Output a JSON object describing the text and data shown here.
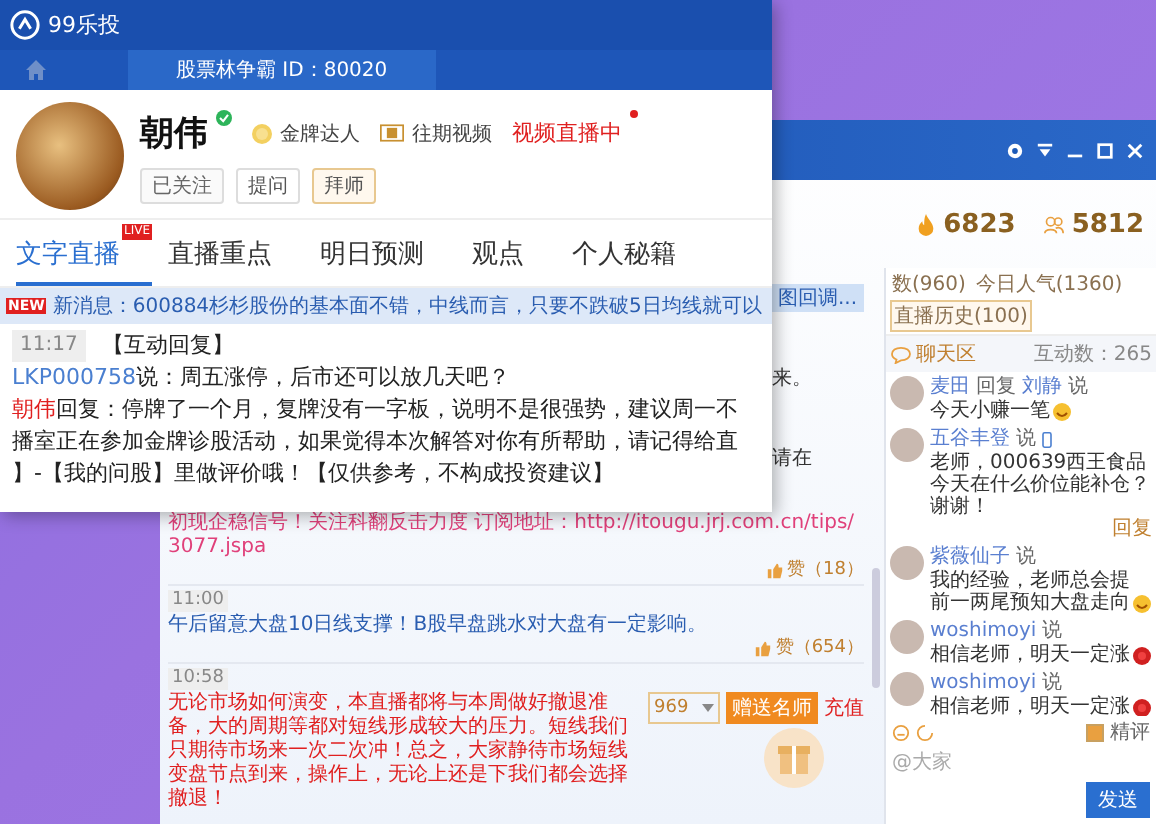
{
  "popup": {
    "app_name": "99乐投",
    "subtitle": "股票林争霸 ID：80020",
    "profile": {
      "name": "朝伟",
      "verified": true,
      "badge": "金牌达人",
      "video_link": "往期视频",
      "live_status": "视频直播中",
      "live": true
    },
    "actions": [
      {
        "label": "已关注",
        "selected": true
      },
      {
        "label": "提问",
        "selected": false
      },
      {
        "label": "拜师",
        "selected": false
      }
    ],
    "tabs": [
      {
        "label": "文字直播",
        "selected": true,
        "badge": "LIVE"
      },
      {
        "label": "直播重点",
        "selected": false
      },
      {
        "label": "明日预测",
        "selected": false
      },
      {
        "label": "观点",
        "selected": false
      },
      {
        "label": "个人秘籍",
        "selected": false
      }
    ],
    "news": {
      "badge": "NEW",
      "text": "新消息：600884杉杉股份的基本面不错，中线而言，只要不跌破5日均线就可以"
    },
    "post": {
      "time": "11:17",
      "title": "【互动回复】",
      "question_user": "LKP000758",
      "question": "说：周五涨停，后市还可以放几天吧？",
      "reply_author": "朝伟",
      "reply_lines": [
        "回复：停牌了一个月，复牌没有一字板，说明不是很强势，建议周一不",
        "播室正在参加金牌诊股活动，如果觉得本次解答对你有所帮助，请记得给直",
        "】-【我的问股】里做评价哦！【仅供参考，不构成投资建议】"
      ]
    }
  },
  "main_window": {
    "stats": [
      {
        "kind": "fire",
        "value": "6823"
      },
      {
        "kind": "people",
        "value": "5812"
      }
    ],
    "fragments": [
      {
        "text": "图回调...",
        "selected": true
      },
      {
        "text": "来。",
        "selected": false
      },
      {
        "text": "请在",
        "selected": false
      }
    ],
    "feed": [
      {
        "text": "初现企稳信号！关注科翻反击力度  订阅地址：http://itougu.jrj.com.cn/tips/3077.jspa",
        "color": "#e0407a",
        "likes": "赞（18）"
      },
      {
        "time": "11:00",
        "text": "午后留意大盘10日线支撑！B股早盘跳水对大盘有一定影响。",
        "color": "#2a5db0",
        "likes": "赞（654）"
      },
      {
        "time": "10:58",
        "text": "无论市场如何演变，本直播都将与本周做好撤退准备，大的周期等都对短线形成较大的压力。短线我们只期待市场来一次二次冲！总之，大家静待市场短线变盘节点到来，操作上，无论上还是下我们都会选择撤退！",
        "color": "#e02020"
      }
    ],
    "gift": {
      "amount": "969",
      "send": "赠送名师",
      "recharge": "充值"
    },
    "chat_tabs": [
      {
        "label": "数(960)",
        "selected": false
      },
      {
        "label": "今日人气(1360)",
        "selected": false
      },
      {
        "label": "直播历史(100)",
        "selected": true
      }
    ],
    "chat": {
      "title": "聊天区",
      "count": "互动数：265",
      "messages": [
        {
          "user": "麦田",
          "action": "回复",
          "target": "刘静",
          "verb": "说",
          "text": "今天小赚一笔",
          "kind": "smile"
        },
        {
          "user": "五谷丰登",
          "verb": "说",
          "mobile": true,
          "text": "老师，000639西王食品今天在什么价位能补仓？谢谢！",
          "reply": "回复"
        },
        {
          "user": "紫薇仙子",
          "verb": "说",
          "text": "我的经验，老师总会提前一两尾预知大盘走向",
          "kind": "smile"
        },
        {
          "user": "woshimoyi",
          "verb": "说",
          "text": "相信老师，明天一定涨",
          "kind": "flower"
        },
        {
          "user": "woshimoyi",
          "verb": "说",
          "text": "相信老师，明天一定涨",
          "kind": "flower"
        }
      ]
    },
    "composer": {
      "featured_label": "精评",
      "featured": true,
      "placeholder": "@大家",
      "send": "发送"
    }
  }
}
